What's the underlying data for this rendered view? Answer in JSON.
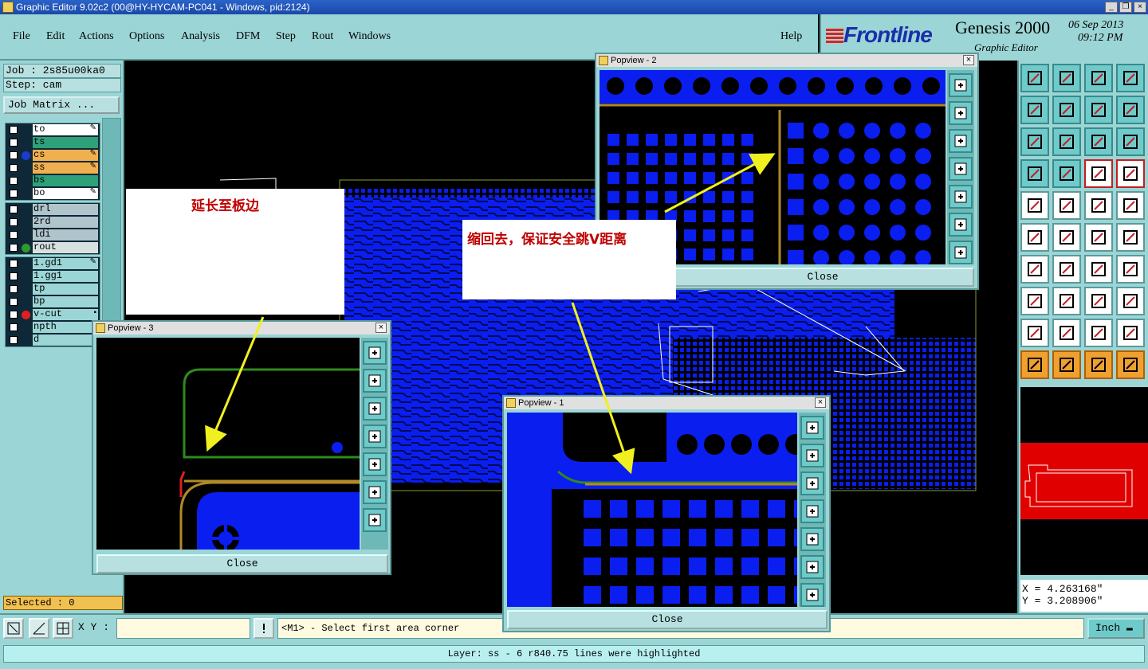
{
  "window": {
    "title": "Graphic Editor 9.02c2 (00@HY-HYCAM-PC041 - Windows, pid:2124)"
  },
  "menu": [
    "File",
    "Edit",
    "Actions",
    "Options",
    "Analysis",
    "DFM",
    "Step",
    "Rout",
    "Windows"
  ],
  "help_label": "Help",
  "brand": {
    "logo": "Frontline",
    "product": "Genesis 2000",
    "subtitle": "Graphic Editor",
    "date": "06 Sep 2013",
    "time": "09:12 PM"
  },
  "job": {
    "job_line": "Job : 2s85u00ka0",
    "step_line": "Step: cam",
    "matrix_button": "Job Matrix ..."
  },
  "layers_group1": [
    {
      "name": "to",
      "color": "#ffffff",
      "dot": "",
      "flag": "✎"
    },
    {
      "name": "ts",
      "color": "#2ea07a",
      "dot": "",
      "flag": ""
    },
    {
      "name": "cs",
      "color": "#f0b050",
      "dot": "#1a3cd0",
      "flag": "✎"
    },
    {
      "name": "ss",
      "color": "#f0b050",
      "dot": "",
      "flag": "✎"
    },
    {
      "name": "bs",
      "color": "#2ea07a",
      "dot": "",
      "flag": ""
    },
    {
      "name": "bo",
      "color": "#ffffff",
      "dot": "",
      "flag": "✎"
    }
  ],
  "layers_group2": [
    {
      "name": "drl",
      "color": "#b0c4cc",
      "dot": "",
      "flag": ""
    },
    {
      "name": "2rd",
      "color": "#b0c4cc",
      "dot": "",
      "flag": ""
    },
    {
      "name": "ldi",
      "color": "#b0c4cc",
      "dot": "",
      "flag": ""
    },
    {
      "name": "rout",
      "color": "#d8e0e0",
      "dot": "#2e9a2e",
      "flag": ""
    }
  ],
  "layers_group3": [
    {
      "name": "1.gd1",
      "color": "#9cd5d5",
      "dot": "",
      "flag": "✎"
    },
    {
      "name": "1.gg1",
      "color": "#9cd5d5",
      "dot": "",
      "flag": ""
    },
    {
      "name": "tp",
      "color": "#9cd5d5",
      "dot": "",
      "flag": ""
    },
    {
      "name": "bp",
      "color": "#9cd5d5",
      "dot": "",
      "flag": ""
    },
    {
      "name": "v-cut",
      "color": "#9cd5d5",
      "dot": "#e02020",
      "flag": "▪"
    },
    {
      "name": "npth",
      "color": "#9cd5d5",
      "dot": "",
      "flag": ""
    },
    {
      "name": "d",
      "color": "#9cd5d5",
      "dot": "",
      "flag": ""
    }
  ],
  "selected_label": "Selected : 0",
  "coords": {
    "x": "X = 4.263168\"",
    "y": "Y = 3.208906\""
  },
  "bottom": {
    "xy_label": "X Y :",
    "xy_value": "",
    "prompt": "<M1> - Select first area corner",
    "unit": "Inch"
  },
  "status": "Layer: ss - 6 r840.75 lines were highlighted",
  "notes": {
    "note1": "延长至板边",
    "note2": "缩回去，保证安全跳V距离"
  },
  "popviews": {
    "p1": {
      "title": "Popview - 1",
      "close": "Close"
    },
    "p2": {
      "title": "Popview - 2",
      "close": "Close"
    },
    "p3": {
      "title": "Popview - 3",
      "close": "Close"
    }
  },
  "colors": {
    "pad_blue": "#0a1ef0",
    "panel_teal": "#9cd5d5",
    "rout_green": "#2e8a1e",
    "vcut_gold": "#b08a2a"
  }
}
